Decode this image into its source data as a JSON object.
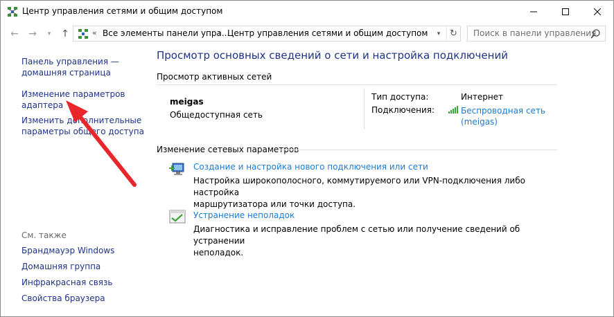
{
  "window": {
    "title": "Центр управления сетями и общим доступом"
  },
  "navigation": {
    "breadcrumb_prefix": "«",
    "breadcrumb_1": "Все элементы панели упра...",
    "breadcrumb_separator": "›",
    "breadcrumb_2": "Центр управления сетями и общим доступом",
    "search_placeholder": "Поиск в панели управления"
  },
  "sidebar": {
    "home_line1": "Панель управления —",
    "home_line2": "домашняя страница",
    "adapter_line1": "Изменение параметров",
    "adapter_line2": "адаптера",
    "sharing_line1": "Изменить дополнительные",
    "sharing_line2": "параметры общего доступа",
    "see_also_label": "См. также",
    "see_also": [
      "Брандмауэр Windows",
      "Домашняя группа",
      "Инфракрасная связь",
      "Свойства браузера"
    ]
  },
  "main": {
    "title": "Просмотр основных сведений о сети и настройка подключений",
    "active_networks_title": "Просмотр активных сетей",
    "network": {
      "name": "meigas",
      "type": "Общедоступная сеть",
      "access_label": "Тип доступа:",
      "access_value": "Интернет",
      "connections_label": "Подключения:",
      "connection_line1": "Беспроводная сеть",
      "connection_line2": "(meigas)"
    },
    "change_settings_title": "Изменение сетевых параметров",
    "tasks": [
      {
        "icon": "new-connection-icon",
        "link": "Создание и настройка нового подключения или сети",
        "desc_line1": "Настройка широкополосного, коммутируемого или VPN-подключения либо настройка",
        "desc_line2": "маршрутизатора или точки доступа."
      },
      {
        "icon": "troubleshoot-icon",
        "link": "Устранение неполадок",
        "desc_line1": "Диагностика и исправление проблем с сетью или получение сведений об устранении",
        "desc_line2": "неполадок."
      }
    ]
  },
  "colors": {
    "link_dark": "#1e3287",
    "link_blue": "#1e7ad1",
    "annotation_arrow": "#e8262b"
  }
}
